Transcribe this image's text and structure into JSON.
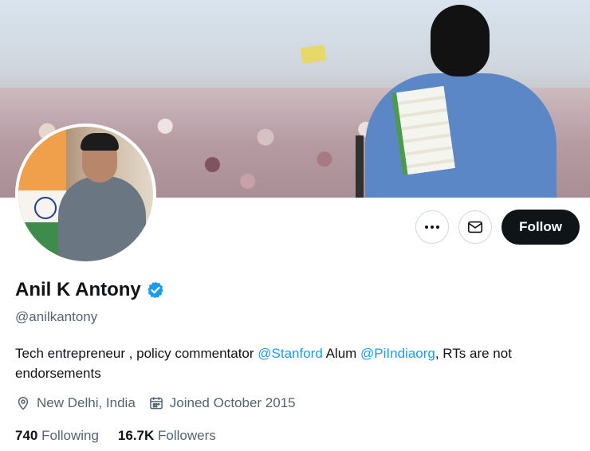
{
  "profile": {
    "name": "Anil K Antony",
    "handle": "@anilkantony",
    "verified": true,
    "bio": {
      "part1": "Tech entrepreneur , policy commentator ",
      "mention1": "@Stanford",
      "part2": " Alum ",
      "mention2": "@PiIndiaorg",
      "part3": ", RTs are not endorsements"
    },
    "location": "New Delhi, India",
    "joined": "Joined October 2015",
    "following_count": "740",
    "following_label": "Following",
    "followers_count": "16.7K",
    "followers_label": "Followers"
  },
  "actions": {
    "more_icon": "more-horizontal-icon",
    "message_icon": "envelope-icon",
    "follow_label": "Follow"
  },
  "colors": {
    "accent": "#1d9bf0",
    "text": "#0f1419",
    "muted": "#536471",
    "follow_bg": "#0f1419"
  }
}
